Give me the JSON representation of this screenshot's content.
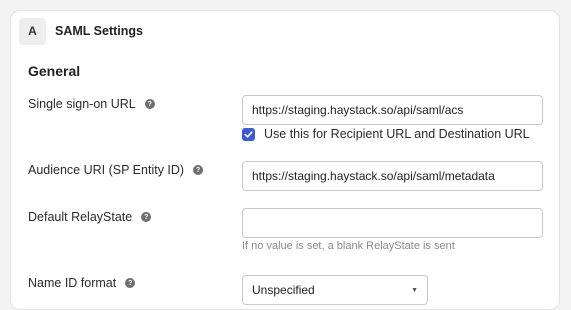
{
  "header": {
    "badge": "A",
    "title": "SAML Settings"
  },
  "section": {
    "title": "General"
  },
  "fields": {
    "sso_url": {
      "label": "Single sign-on URL",
      "value": "https://staging.haystack.so/api/saml/acs"
    },
    "recipient_checkbox": {
      "label": "Use this for Recipient URL and Destination URL",
      "checked": true
    },
    "audience_uri": {
      "label": "Audience URI (SP Entity ID)",
      "value": "https://staging.haystack.so/api/saml/metadata"
    },
    "relay_state": {
      "label": "Default RelayState",
      "value": "",
      "hint": "If no value is set, a blank RelayState is sent"
    },
    "name_id_format": {
      "label": "Name ID format",
      "value": "Unspecified"
    }
  },
  "help_glyph": "?",
  "colors": {
    "accent": "#3a5bd9"
  }
}
